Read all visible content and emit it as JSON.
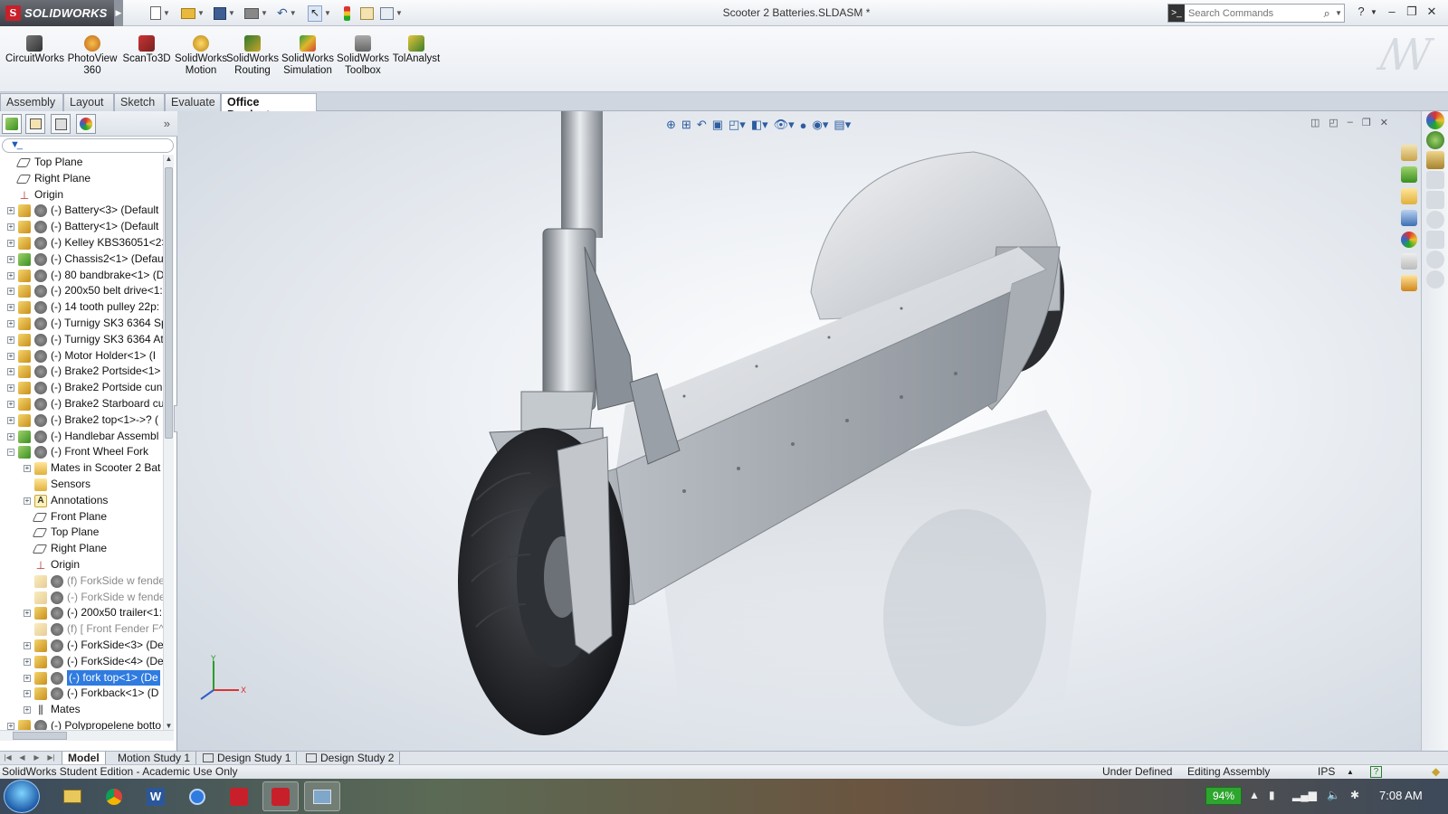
{
  "app": {
    "logo_text": "SOLIDWORKS",
    "document_title": "Scooter 2 Batteries.SLDASM *",
    "search_placeholder": "Search Commands"
  },
  "ribbon": {
    "buttons": [
      {
        "label": "CircuitWorks"
      },
      {
        "label": "PhotoView 360"
      },
      {
        "label": "ScanTo3D"
      },
      {
        "label": "SolidWorks Motion"
      },
      {
        "label": "SolidWorks Routing"
      },
      {
        "label": "SolidWorks Simulation"
      },
      {
        "label": "SolidWorks Toolbox"
      },
      {
        "label": "TolAnalyst"
      }
    ]
  },
  "command_tabs": [
    "Assembly",
    "Layout",
    "Sketch",
    "Evaluate",
    "Office Products"
  ],
  "active_command_tab": "Office Products",
  "tree": {
    "items": [
      {
        "label": "Top Plane",
        "icon": "plane-icon",
        "indent": 0,
        "expander": "none"
      },
      {
        "label": "Right Plane",
        "icon": "plane-icon",
        "indent": 0,
        "expander": "none"
      },
      {
        "label": "Origin",
        "icon": "origin-icon",
        "indent": 0,
        "expander": "none"
      },
      {
        "label": "(-) Battery<3> (Default",
        "icon": "part-icon",
        "indent": 0,
        "expander": "plus"
      },
      {
        "label": "(-) Battery<1> (Default",
        "icon": "part-icon",
        "indent": 0,
        "expander": "plus"
      },
      {
        "label": "(-) Kelley KBS36051<2>",
        "icon": "part-icon",
        "indent": 0,
        "expander": "plus"
      },
      {
        "label": "(-) Chassis2<1> (Defau",
        "icon": "assembly-icon",
        "indent": 0,
        "expander": "plus"
      },
      {
        "label": "(-) 80 bandbrake<1> (D",
        "icon": "part-icon",
        "indent": 0,
        "expander": "plus"
      },
      {
        "label": "(-) 200x50 belt drive<1:",
        "icon": "part-icon",
        "indent": 0,
        "expander": "plus"
      },
      {
        "label": "(-) 14 tooth pulley 22p:",
        "icon": "part-icon",
        "indent": 0,
        "expander": "plus"
      },
      {
        "label": "(-) Turnigy SK3 6364 Sp",
        "icon": "part-icon",
        "indent": 0,
        "expander": "plus"
      },
      {
        "label": "(-) Turnigy SK3 6364 At",
        "icon": "part-icon",
        "indent": 0,
        "expander": "plus"
      },
      {
        "label": "(-) Motor Holder<1> (I",
        "icon": "part-icon",
        "indent": 0,
        "expander": "plus"
      },
      {
        "label": "(-) Brake2 Portside<1>",
        "icon": "part-icon",
        "indent": 0,
        "expander": "plus"
      },
      {
        "label": "(-) Brake2 Portside cun",
        "icon": "part-icon",
        "indent": 0,
        "expander": "plus"
      },
      {
        "label": "(-) Brake2 Starboard cu",
        "icon": "part-icon",
        "indent": 0,
        "expander": "plus"
      },
      {
        "label": "(-) Brake2 top<1>->? (",
        "icon": "part-icon",
        "indent": 0,
        "expander": "plus"
      },
      {
        "label": "(-) Handlebar Assembl",
        "icon": "assembly-icon",
        "indent": 0,
        "expander": "plus"
      },
      {
        "label": "(-) Front Wheel Fork",
        "icon": "assembly-icon",
        "indent": 0,
        "expander": "minus"
      },
      {
        "label": "Mates in Scooter 2 Bat",
        "icon": "folder-icon",
        "indent": 1,
        "expander": "plus"
      },
      {
        "label": "Sensors",
        "icon": "folder-icon",
        "indent": 1,
        "expander": "none"
      },
      {
        "label": "Annotations",
        "icon": "annotation-icon",
        "indent": 1,
        "expander": "plus"
      },
      {
        "label": "Front Plane",
        "icon": "plane-icon",
        "indent": 1,
        "expander": "none"
      },
      {
        "label": "Top Plane",
        "icon": "plane-icon",
        "indent": 1,
        "expander": "none"
      },
      {
        "label": "Right Plane",
        "icon": "plane-icon",
        "indent": 1,
        "expander": "none"
      },
      {
        "label": "Origin",
        "icon": "origin-icon",
        "indent": 1,
        "expander": "none"
      },
      {
        "label": "(f) ForkSide w fender<",
        "icon": "part-icon",
        "indent": 1,
        "expander": "none",
        "dim": true
      },
      {
        "label": "(-) ForkSide w fender<",
        "icon": "part-icon",
        "indent": 1,
        "expander": "none",
        "dim": true
      },
      {
        "label": "(-) 200x50 trailer<1:",
        "icon": "part-icon",
        "indent": 1,
        "expander": "plus"
      },
      {
        "label": "(f) [ Front Fender F^Fr",
        "icon": "part-icon",
        "indent": 1,
        "expander": "none",
        "dim": true
      },
      {
        "label": "(-) ForkSide<3> (De",
        "icon": "part-icon",
        "indent": 1,
        "expander": "plus"
      },
      {
        "label": "(-) ForkSide<4> (De",
        "icon": "part-icon",
        "indent": 1,
        "expander": "plus"
      },
      {
        "label": "(-) fork top<1> (De",
        "icon": "part-icon",
        "indent": 1,
        "expander": "plus",
        "selected": true
      },
      {
        "label": "(-) Forkback<1> (D",
        "icon": "part-icon",
        "indent": 1,
        "expander": "plus"
      },
      {
        "label": "Mates",
        "icon": "mates-icon",
        "indent": 1,
        "expander": "plus"
      },
      {
        "label": "(-) Polypropelene botto",
        "icon": "part-icon",
        "indent": 0,
        "expander": "plus"
      }
    ]
  },
  "bottom_tabs": [
    "Model",
    "Motion Study 1",
    "Design Study 1",
    "Design Study 2"
  ],
  "active_bottom_tab": "Model",
  "status": {
    "left": "SolidWorks Student Edition - Academic Use Only",
    "state": "Under Defined",
    "mode": "Editing Assembly",
    "units": "IPS"
  },
  "taskbar": {
    "battery": "94%",
    "time": "7:08 AM"
  },
  "colors": {
    "selection": "#2f7be0",
    "brand_red": "#c8202a"
  }
}
